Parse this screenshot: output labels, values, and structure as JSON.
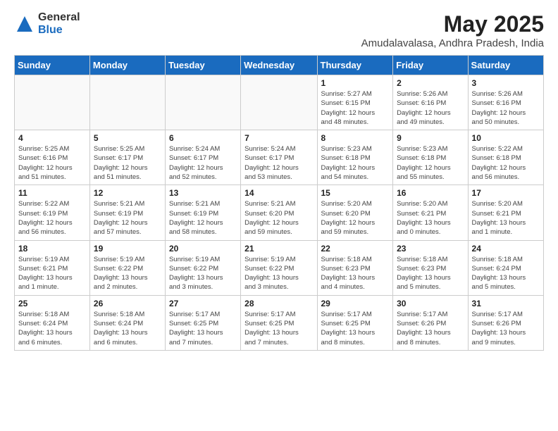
{
  "logo": {
    "general": "General",
    "blue": "Blue"
  },
  "title": "May 2025",
  "location": "Amudalavalasa, Andhra Pradesh, India",
  "days_of_week": [
    "Sunday",
    "Monday",
    "Tuesday",
    "Wednesday",
    "Thursday",
    "Friday",
    "Saturday"
  ],
  "weeks": [
    [
      {
        "day": "",
        "info": ""
      },
      {
        "day": "",
        "info": ""
      },
      {
        "day": "",
        "info": ""
      },
      {
        "day": "",
        "info": ""
      },
      {
        "day": "1",
        "info": "Sunrise: 5:27 AM\nSunset: 6:15 PM\nDaylight: 12 hours\nand 48 minutes."
      },
      {
        "day": "2",
        "info": "Sunrise: 5:26 AM\nSunset: 6:16 PM\nDaylight: 12 hours\nand 49 minutes."
      },
      {
        "day": "3",
        "info": "Sunrise: 5:26 AM\nSunset: 6:16 PM\nDaylight: 12 hours\nand 50 minutes."
      }
    ],
    [
      {
        "day": "4",
        "info": "Sunrise: 5:25 AM\nSunset: 6:16 PM\nDaylight: 12 hours\nand 51 minutes."
      },
      {
        "day": "5",
        "info": "Sunrise: 5:25 AM\nSunset: 6:17 PM\nDaylight: 12 hours\nand 51 minutes."
      },
      {
        "day": "6",
        "info": "Sunrise: 5:24 AM\nSunset: 6:17 PM\nDaylight: 12 hours\nand 52 minutes."
      },
      {
        "day": "7",
        "info": "Sunrise: 5:24 AM\nSunset: 6:17 PM\nDaylight: 12 hours\nand 53 minutes."
      },
      {
        "day": "8",
        "info": "Sunrise: 5:23 AM\nSunset: 6:18 PM\nDaylight: 12 hours\nand 54 minutes."
      },
      {
        "day": "9",
        "info": "Sunrise: 5:23 AM\nSunset: 6:18 PM\nDaylight: 12 hours\nand 55 minutes."
      },
      {
        "day": "10",
        "info": "Sunrise: 5:22 AM\nSunset: 6:18 PM\nDaylight: 12 hours\nand 56 minutes."
      }
    ],
    [
      {
        "day": "11",
        "info": "Sunrise: 5:22 AM\nSunset: 6:19 PM\nDaylight: 12 hours\nand 56 minutes."
      },
      {
        "day": "12",
        "info": "Sunrise: 5:21 AM\nSunset: 6:19 PM\nDaylight: 12 hours\nand 57 minutes."
      },
      {
        "day": "13",
        "info": "Sunrise: 5:21 AM\nSunset: 6:19 PM\nDaylight: 12 hours\nand 58 minutes."
      },
      {
        "day": "14",
        "info": "Sunrise: 5:21 AM\nSunset: 6:20 PM\nDaylight: 12 hours\nand 59 minutes."
      },
      {
        "day": "15",
        "info": "Sunrise: 5:20 AM\nSunset: 6:20 PM\nDaylight: 12 hours\nand 59 minutes."
      },
      {
        "day": "16",
        "info": "Sunrise: 5:20 AM\nSunset: 6:21 PM\nDaylight: 13 hours\nand 0 minutes."
      },
      {
        "day": "17",
        "info": "Sunrise: 5:20 AM\nSunset: 6:21 PM\nDaylight: 13 hours\nand 1 minute."
      }
    ],
    [
      {
        "day": "18",
        "info": "Sunrise: 5:19 AM\nSunset: 6:21 PM\nDaylight: 13 hours\nand 1 minute."
      },
      {
        "day": "19",
        "info": "Sunrise: 5:19 AM\nSunset: 6:22 PM\nDaylight: 13 hours\nand 2 minutes."
      },
      {
        "day": "20",
        "info": "Sunrise: 5:19 AM\nSunset: 6:22 PM\nDaylight: 13 hours\nand 3 minutes."
      },
      {
        "day": "21",
        "info": "Sunrise: 5:19 AM\nSunset: 6:22 PM\nDaylight: 13 hours\nand 3 minutes."
      },
      {
        "day": "22",
        "info": "Sunrise: 5:18 AM\nSunset: 6:23 PM\nDaylight: 13 hours\nand 4 minutes."
      },
      {
        "day": "23",
        "info": "Sunrise: 5:18 AM\nSunset: 6:23 PM\nDaylight: 13 hours\nand 5 minutes."
      },
      {
        "day": "24",
        "info": "Sunrise: 5:18 AM\nSunset: 6:24 PM\nDaylight: 13 hours\nand 5 minutes."
      }
    ],
    [
      {
        "day": "25",
        "info": "Sunrise: 5:18 AM\nSunset: 6:24 PM\nDaylight: 13 hours\nand 6 minutes."
      },
      {
        "day": "26",
        "info": "Sunrise: 5:18 AM\nSunset: 6:24 PM\nDaylight: 13 hours\nand 6 minutes."
      },
      {
        "day": "27",
        "info": "Sunrise: 5:17 AM\nSunset: 6:25 PM\nDaylight: 13 hours\nand 7 minutes."
      },
      {
        "day": "28",
        "info": "Sunrise: 5:17 AM\nSunset: 6:25 PM\nDaylight: 13 hours\nand 7 minutes."
      },
      {
        "day": "29",
        "info": "Sunrise: 5:17 AM\nSunset: 6:25 PM\nDaylight: 13 hours\nand 8 minutes."
      },
      {
        "day": "30",
        "info": "Sunrise: 5:17 AM\nSunset: 6:26 PM\nDaylight: 13 hours\nand 8 minutes."
      },
      {
        "day": "31",
        "info": "Sunrise: 5:17 AM\nSunset: 6:26 PM\nDaylight: 13 hours\nand 9 minutes."
      }
    ]
  ]
}
